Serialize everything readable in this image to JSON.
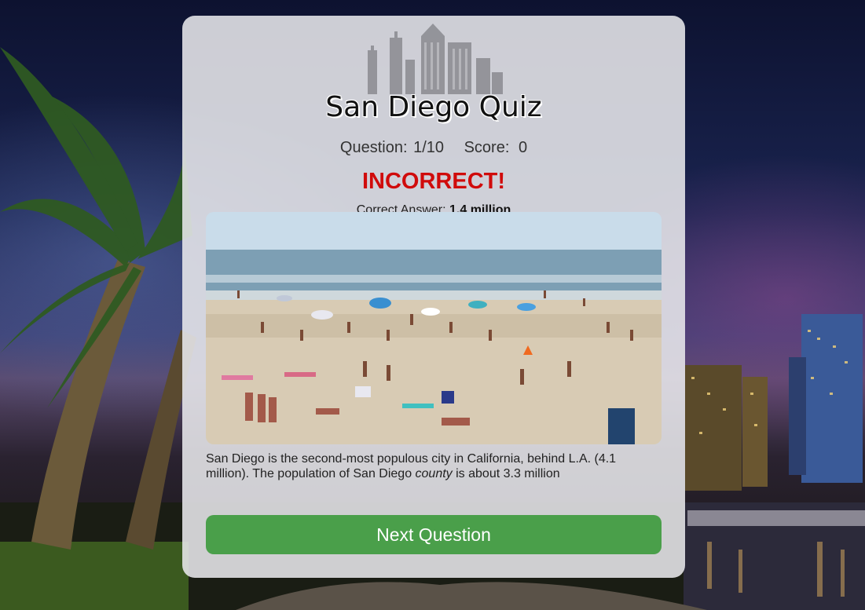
{
  "quiz": {
    "title": "San Diego Quiz",
    "question_label": "Question:",
    "question_value": "1/10",
    "score_label": "Score:",
    "score_value": "0",
    "result": "INCORRECT!",
    "correct_answer_label": "Correct Answer:",
    "correct_answer_value": "1.4 million",
    "fact_part1": "San Diego is the second-most populous city in California, behind L.A. (4.1 million). The population of San Diego ",
    "fact_emphasis": "county",
    "fact_part2": " is about 3.3 million",
    "next_button": "Next Question"
  },
  "colors": {
    "result": "#d00b0b",
    "button": "#4a9f4a",
    "card": "#e8e8ec"
  },
  "icons": {
    "logo": "city-skyline-icon",
    "photo": "beach-photo"
  }
}
